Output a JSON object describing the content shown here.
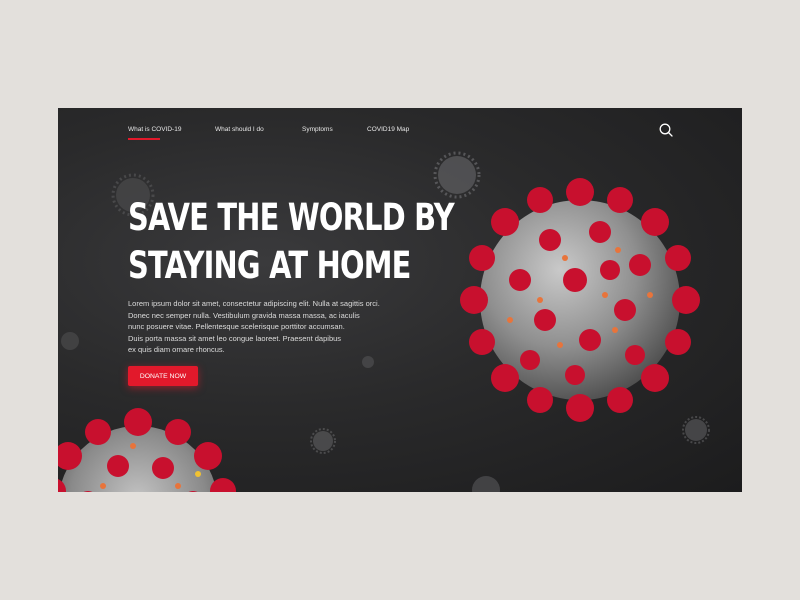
{
  "nav": {
    "items": [
      {
        "label": "What is COVID-19",
        "active": true
      },
      {
        "label": "What should I do",
        "active": false
      },
      {
        "label": "Symptoms",
        "active": false
      },
      {
        "label": "COVID19 Map",
        "active": false
      }
    ],
    "search_icon": "search-icon"
  },
  "hero": {
    "headline_line1": "SAVE THE WORLD BY",
    "headline_line2": "STAYING AT HOME",
    "body_lines": [
      "Lorem ipsum dolor sit amet, consectetur adipiscing elit. Nulla at sagittis orci.",
      "Donec nec semper nulla. Vestibulum gravida massa massa, ac iaculis",
      "nunc posuere vitae. Pellentesque scelerisque porttitor accumsan.",
      "Duis porta massa sit amet leo congue laoreet. Praesent dapibus",
      "ex quis diam ornare rhoncus."
    ],
    "cta_label": "DONATE NOW"
  },
  "colors": {
    "accent": "#e2192b",
    "background": "#2a2a2b",
    "page_bg": "#e3e0dc",
    "text": "#ffffff",
    "virus_body": "#9a9a9a",
    "virus_spike": "#c8102e"
  }
}
